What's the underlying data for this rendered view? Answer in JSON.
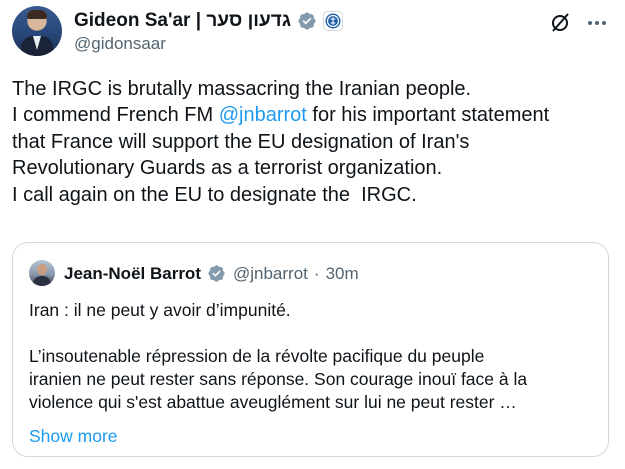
{
  "author": {
    "display_name": "Gideon Sa'ar | גדעון סער",
    "handle": "@gidonsaar",
    "verified_badge": "verified-gray-badge-icon",
    "affiliation_badge": "government-emblem-icon"
  },
  "toolbar": {
    "grok_icon": "slash-circle-icon",
    "more_icon": "more-horizontal-icon"
  },
  "tweet": {
    "lines": [
      {
        "before": "The IRGC is brutally massacring the Iranian people.",
        "mention": "",
        "after": ""
      },
      {
        "before": "I commend French FM ",
        "mention": "@jnbarrot",
        "after": " for his important statement"
      },
      {
        "before": "that France will support the EU designation of Iran's",
        "mention": "",
        "after": ""
      },
      {
        "before": "Revolutionary Guards as a terrorist organization.",
        "mention": "",
        "after": ""
      },
      {
        "before": "I call again on the EU to designate the  IRGC.",
        "mention": "",
        "after": ""
      }
    ]
  },
  "quote": {
    "name": "Jean-Noël Barrot",
    "handle": "@jnbarrot",
    "separator": "·",
    "time": "30m",
    "paragraph1": "Iran : il ne peut y avoir d’impunité.",
    "paragraph2_lines": [
      "L’insoutenable répression de la révolte pacifique du peuple",
      "iranien ne peut rester sans réponse. Son courage inouï face à la",
      "violence qui s'est abattue aveuglément sur lui ne peut rester …"
    ],
    "show_more": "Show more"
  },
  "colors": {
    "text": "#0f1419",
    "secondary": "#536471",
    "link": "#1d9bf0",
    "border": "#cfd9de"
  }
}
